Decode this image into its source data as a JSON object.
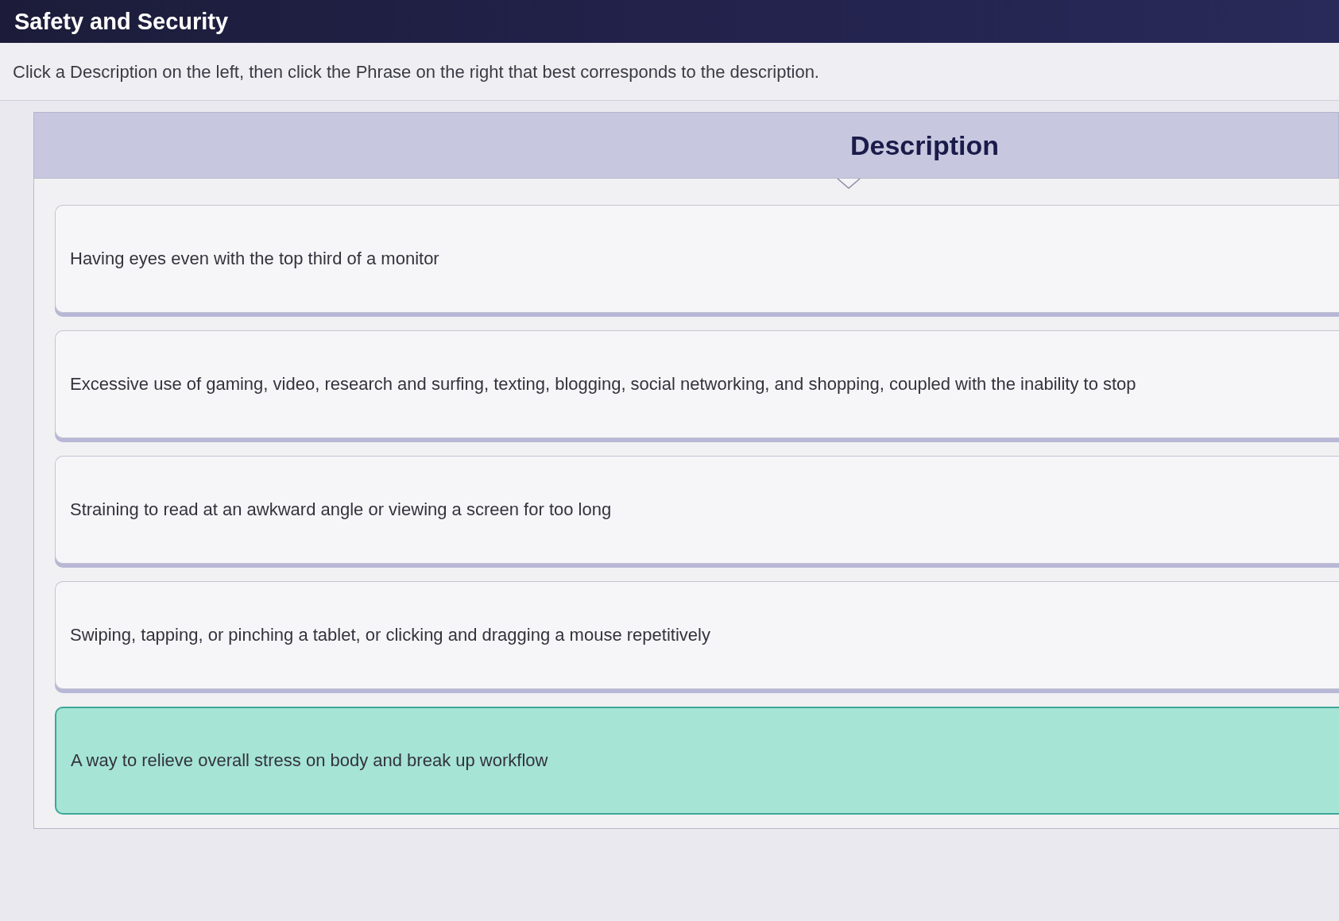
{
  "window": {
    "title": "Safety and Security"
  },
  "instructions": "Click a Description on the left, then click the Phrase on the right that best corresponds to the description.",
  "column": {
    "heading": "Description"
  },
  "descriptions": [
    {
      "text": "Having eyes even with the top third of a monitor",
      "selected": false
    },
    {
      "text": "Excessive use of gaming, video, research and surfing, texting, blogging, social networking, and shopping, coupled with the inability to stop",
      "selected": false
    },
    {
      "text": "Straining to read at an awkward angle or viewing a screen for too long",
      "selected": false
    },
    {
      "text": "Swiping, tapping, or pinching a tablet, or clicking and dragging a mouse repetitively",
      "selected": false
    },
    {
      "text": "A way to relieve overall stress on body and break up workflow",
      "selected": true
    }
  ]
}
